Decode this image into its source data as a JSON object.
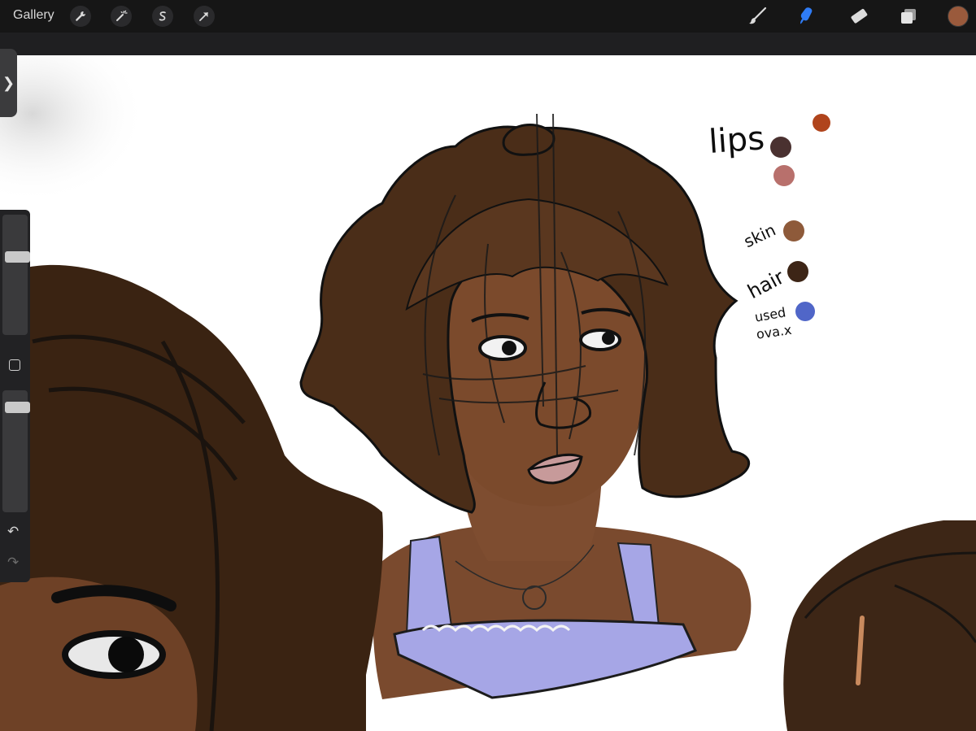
{
  "toolbar": {
    "gallery_label": "Gallery",
    "left_tools": [
      {
        "name": "wrench-icon"
      },
      {
        "name": "magic-wand-icon"
      },
      {
        "name": "selection-icon"
      },
      {
        "name": "transform-arrow-icon"
      }
    ],
    "right_tools": [
      {
        "name": "brush-icon"
      },
      {
        "name": "smudge-icon",
        "active": true
      },
      {
        "name": "eraser-icon"
      },
      {
        "name": "layers-icon"
      }
    ],
    "current_color": "#9a5a3c",
    "active_color": "#2f7cf6"
  },
  "canvas": {
    "palette_notes": {
      "lips_label": "lips",
      "skin_label": "skin",
      "hair_label": "hair",
      "used_label": "used",
      "other_label": "ova.x"
    },
    "swatches": [
      {
        "name": "lips-dark",
        "color": "#4a3130"
      },
      {
        "name": "lips-pink",
        "color": "#b8706c"
      },
      {
        "name": "accent-red",
        "color": "#b0441c"
      },
      {
        "name": "skin",
        "color": "#8e5a3a"
      },
      {
        "name": "hair",
        "color": "#3d2516"
      },
      {
        "name": "used-blue",
        "color": "#5066c8"
      }
    ]
  },
  "sidebar": {
    "handle_glyph": "❯",
    "undo_glyph": "↶",
    "redo_glyph": "↷",
    "brush_size_fraction": 0.38,
    "opacity_fraction": 0.1
  }
}
